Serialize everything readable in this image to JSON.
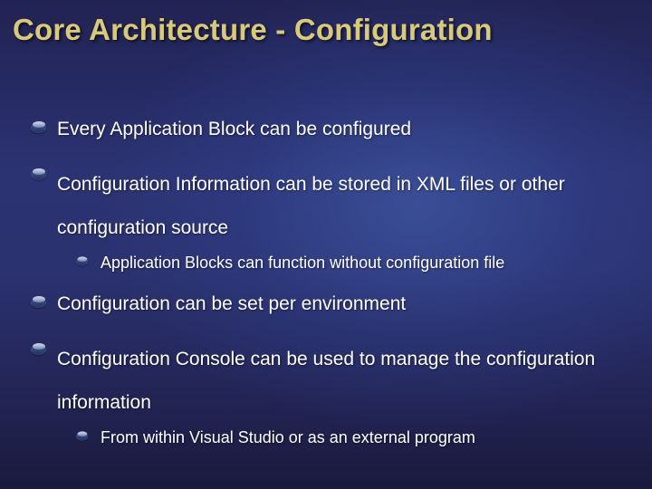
{
  "title": "Core Architecture - Configuration",
  "bullets": [
    {
      "text": "Every Application Block can be configured"
    },
    {
      "text": "Configuration Information can be stored in XML files or other configuration source",
      "sub": [
        {
          "text": "Application Blocks can function without configuration file"
        }
      ]
    },
    {
      "text": "Configuration can be set per environment"
    },
    {
      "text": "Configuration Console can be used to manage the configuration information",
      "sub": [
        {
          "text": "From within Visual Studio or as an external program"
        }
      ]
    }
  ]
}
